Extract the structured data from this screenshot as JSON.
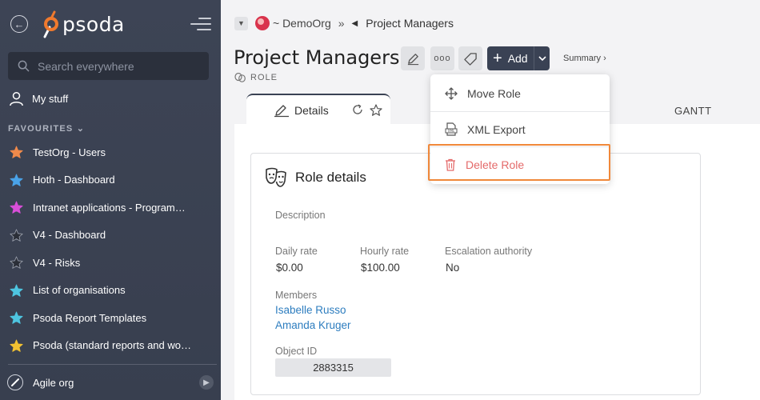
{
  "sidebar": {
    "logo_text": "psoda",
    "search_placeholder": "Search everywhere",
    "my_stuff": "My stuff",
    "favourites_heading": "FAVOURITES",
    "favourites": [
      {
        "label": "TestOrg - Users",
        "star_color": "#f08a4b"
      },
      {
        "label": "Hoth - Dashboard",
        "star_color": "#4aa3e8"
      },
      {
        "label": "Intranet applications - Programme...",
        "star_color": "#d84fd8"
      },
      {
        "label": "V4 - Dashboard",
        "star_color": "#2b2f38"
      },
      {
        "label": "V4 - Risks",
        "star_color": "#2b2f38"
      },
      {
        "label": "List of organisations",
        "star_color": "#4ec5e0"
      },
      {
        "label": "Psoda Report Templates",
        "star_color": "#4ec5e0"
      },
      {
        "label": "Psoda (standard reports and work...",
        "star_color": "#f2c232"
      }
    ],
    "org_switch": "Agile org"
  },
  "breadcrumb": {
    "org": "~ DemoOrg",
    "separator": "»",
    "current": "Project Managers"
  },
  "page": {
    "title": "Project Managers",
    "type_label": "ROLE",
    "more_label": "ooo",
    "add_label": "Add",
    "summary_label": "Summary ›"
  },
  "tabs": {
    "details": "Details",
    "gantt": "GANTT"
  },
  "card": {
    "title": "Role details",
    "description_label": "Description",
    "daily_rate_label": "Daily rate",
    "daily_rate": "$0.00",
    "hourly_rate_label": "Hourly rate",
    "hourly_rate": "$100.00",
    "escalation_label": "Escalation authority",
    "escalation": "No",
    "members_label": "Members",
    "members": [
      "Isabelle Russo",
      "Amanda Kruger"
    ],
    "object_id_label": "Object ID",
    "object_id": "2883315"
  },
  "menu": {
    "move": "Move Role",
    "xml": "XML Export",
    "delete": "Delete Role"
  },
  "colors": {
    "sidebar_bg": "#3b4252",
    "add_button": "#3a4254",
    "link": "#2d7dbf",
    "delete": "#e46a6a",
    "highlight": "#f0883a",
    "logo_accent": "#f07a2e"
  }
}
